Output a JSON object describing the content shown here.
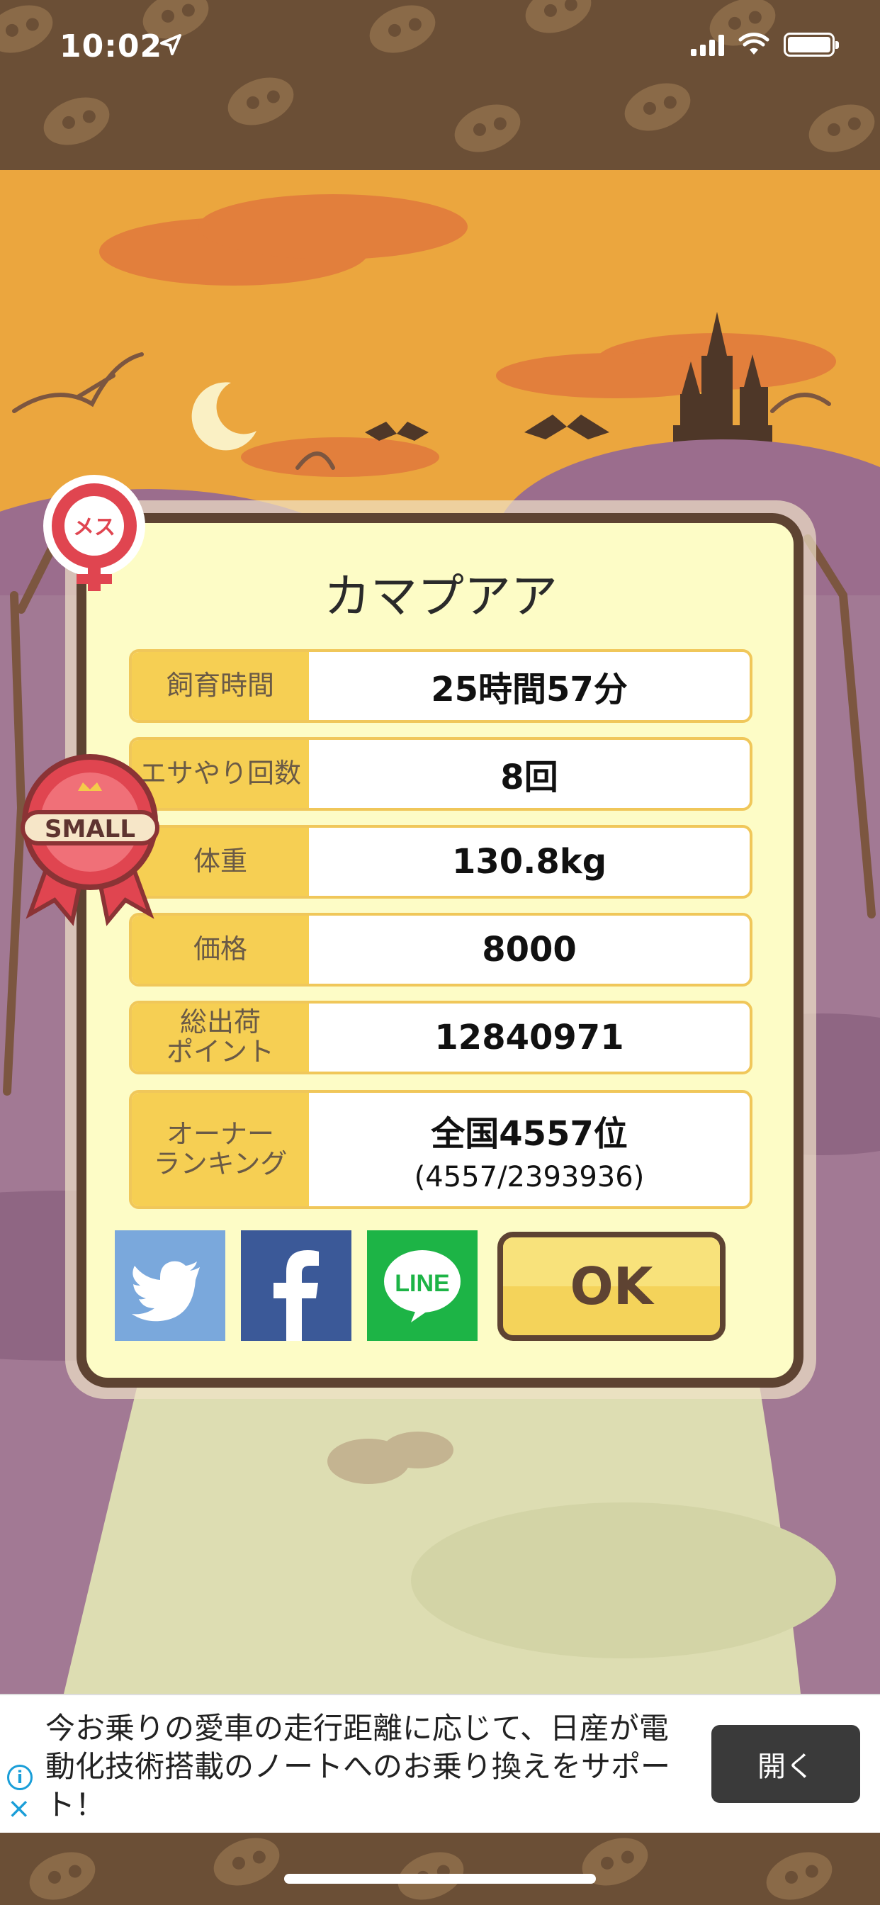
{
  "status_bar": {
    "time": "10:02"
  },
  "pig": {
    "name": "カマプアア",
    "gender_badge": "メス",
    "size_ribbon": "SMALL"
  },
  "stats": [
    {
      "label": "飼育時間",
      "value": "25時間57分"
    },
    {
      "label": "エサやり回数",
      "value": "8回"
    },
    {
      "label": "体重",
      "value": "130.8kg"
    },
    {
      "label": "価格",
      "value": "8000"
    },
    {
      "label": "総出荷\nポイント",
      "value": "12840971"
    },
    {
      "label": "オーナー\nランキング",
      "value": "全国4557位",
      "sub": "(4557/2393936)"
    }
  ],
  "share": {
    "twitter": "twitter-share",
    "facebook": "facebook-share",
    "line_label": "LINE"
  },
  "ok_label": "OK",
  "ad": {
    "text": "今お乗りの愛車の走行距離に応じて、日産が電動化技術搭載のノートへのお乗り換えをサポート！",
    "button": "開く"
  },
  "colors": {
    "accent": "#f6cf53",
    "frame": "#5e4332",
    "twitter": "#7aa8dc",
    "facebook": "#3b5998",
    "line": "#1db446"
  }
}
